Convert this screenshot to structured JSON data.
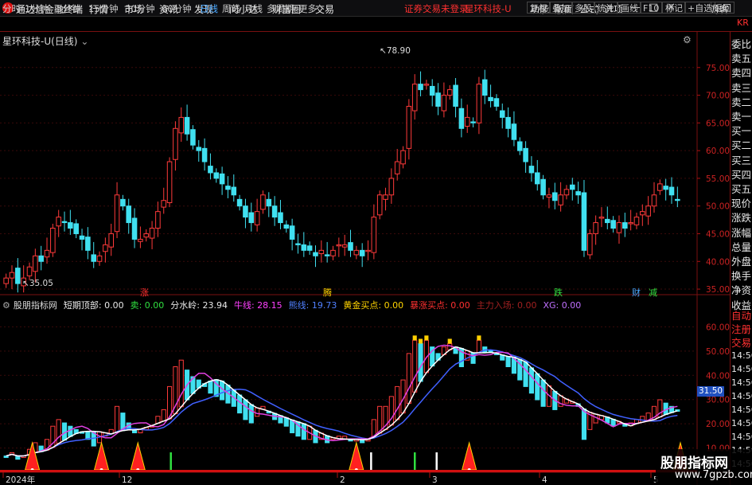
{
  "topbar": {
    "app_title": "通达信金融终端",
    "menu": [
      "行情",
      "市场",
      "资讯",
      "发现",
      "问小达",
      "财富圈",
      "交易"
    ],
    "login_warning": "证券交易未登录",
    "stock": "星环科技-U",
    "right_menu": [
      "功能",
      "版面",
      "公式",
      "选项"
    ],
    "guest": "游客"
  },
  "periodbar": {
    "periods": [
      "分时",
      "1分钟",
      "5分钟",
      "15分钟",
      "30分钟",
      "60分钟",
      "日线",
      "周线",
      "月线",
      "多周期",
      "更多"
    ],
    "active": "日线",
    "tools": [
      "复权",
      "叠加",
      "多股",
      "统计",
      "画线",
      "F10",
      "标记",
      "+自选",
      "返回"
    ],
    "corner": "KR"
  },
  "main_chart": {
    "title": "星环科技-U(日线)",
    "high_label": "78.90",
    "low_label": "35.05",
    "y_ticks": [
      "75.00",
      "70.00",
      "65.00",
      "60.00",
      "55.00",
      "50.00",
      "45.00",
      "40.00",
      "35.00"
    ],
    "tags": [
      {
        "text": "涨",
        "color": "#ff3030"
      },
      {
        "text": "腾",
        "color": "#ffd400"
      },
      {
        "text": "跌",
        "color": "#30e040"
      },
      {
        "text": "财",
        "color": "#4aa8ff"
      },
      {
        "text": "减",
        "color": "#30e040"
      }
    ]
  },
  "indicator": {
    "name": "股朋指标网",
    "items": [
      {
        "label": "短期顶部:",
        "value": "0.00",
        "color": "#e8e8e8"
      },
      {
        "label": "卖:",
        "value": "0.00",
        "color": "#30e040"
      },
      {
        "label": "分水岭:",
        "value": "23.94",
        "color": "#e8e8e8"
      },
      {
        "label": "牛线:",
        "value": "28.15",
        "color": "#ff40ff"
      },
      {
        "label": "熊线:",
        "value": "19.73",
        "color": "#5080ff"
      },
      {
        "label": "黄金买点:",
        "value": "0.00",
        "color": "#ffd400"
      },
      {
        "label": "暴涨买点:",
        "value": "0.00",
        "color": "#ff3030"
      },
      {
        "label": "主力入场:",
        "value": "0.00",
        "color": "#a02020"
      },
      {
        "label": "XG:",
        "value": "0.00",
        "color": "#c070ff"
      }
    ],
    "y_ticks": [
      "60.00",
      "50.00",
      "40.00",
      "30.00",
      "20.00",
      "10.00"
    ],
    "current_label": "31.50"
  },
  "x_axis": [
    "2024年",
    "12",
    "2",
    "3",
    "4",
    "5"
  ],
  "side_panel": {
    "items": [
      "委比",
      "卖五",
      "卖四",
      "卖三",
      "卖二",
      "卖一",
      "买一",
      "买二",
      "买三",
      "买四",
      "买五",
      "现价",
      "涨跌",
      "涨幅",
      "总量",
      "外盘",
      "换手",
      "净资",
      "收益"
    ],
    "lower": [
      "自动",
      "注册",
      "交易"
    ],
    "times": [
      "14:56",
      "14:56",
      "14:56",
      "14:56",
      "14:56",
      "14:56",
      "14:56",
      "14:56",
      "14:56"
    ]
  },
  "watermark": {
    "title": "股朋指标网",
    "url": "www.7gpzb.com"
  },
  "chart_data": {
    "type": "candlestick",
    "title": "星环科技-U(日线)",
    "ylim": [
      34,
      80
    ],
    "closes": [
      37,
      38,
      36,
      37,
      39,
      41,
      40,
      42,
      46,
      48,
      47,
      46,
      45,
      44,
      42,
      40,
      41,
      43,
      45,
      52,
      50,
      47,
      44,
      44,
      45,
      46,
      49,
      51,
      58,
      64,
      66,
      63,
      61,
      60,
      58,
      56,
      55,
      54,
      53,
      52,
      50,
      48,
      47,
      49,
      52,
      50,
      48,
      47,
      46,
      44,
      43,
      42,
      42,
      41,
      42,
      41,
      42,
      43,
      43,
      42,
      42,
      41,
      42,
      48,
      52,
      52,
      55,
      58,
      60,
      68,
      72,
      71,
      72,
      70,
      68,
      70,
      71,
      68,
      64,
      66,
      65,
      72,
      70,
      69,
      68,
      66,
      64,
      62,
      60,
      58,
      56,
      54,
      52,
      52,
      51,
      52,
      53,
      53,
      52,
      42,
      45,
      47,
      48,
      47,
      46,
      47,
      46,
      47,
      48,
      49,
      50,
      52,
      54,
      53,
      52,
      51
    ]
  }
}
